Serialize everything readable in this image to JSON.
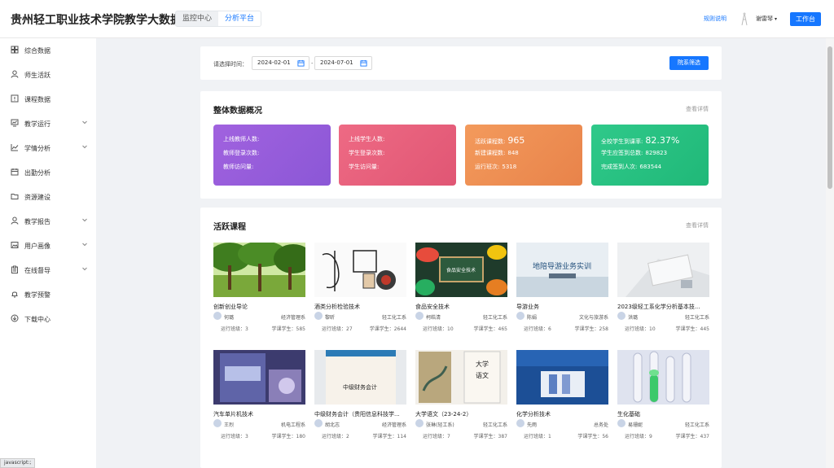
{
  "header": {
    "brand": "贵州轻工职业技术学院教学大数据",
    "tabs": [
      "监控中心",
      "分析平台"
    ],
    "rules_link": "规则说明",
    "user_name": "谢雷琴",
    "workbench_label": "工作台"
  },
  "sidebar": {
    "items": [
      {
        "label": "综合数据",
        "icon": "grid-icon",
        "expandable": false
      },
      {
        "label": "师生活跃",
        "icon": "user-icon",
        "expandable": false
      },
      {
        "label": "课程数据",
        "icon": "info-box-icon",
        "expandable": false
      },
      {
        "label": "教学运行",
        "icon": "monitor-chart-icon",
        "expandable": true
      },
      {
        "label": "学情分析",
        "icon": "line-chart-icon",
        "expandable": true
      },
      {
        "label": "出勤分析",
        "icon": "calendar-icon",
        "expandable": false
      },
      {
        "label": "资源建设",
        "icon": "folder-icon",
        "expandable": false
      },
      {
        "label": "教学报告",
        "icon": "user-report-icon",
        "expandable": true
      },
      {
        "label": "用户画像",
        "icon": "image-icon",
        "expandable": true
      },
      {
        "label": "在线督导",
        "icon": "clipboard-icon",
        "expandable": true
      },
      {
        "label": "教学预警",
        "icon": "bell-icon",
        "expandable": false
      },
      {
        "label": "下载中心",
        "icon": "download-icon",
        "expandable": false
      }
    ]
  },
  "filter": {
    "label": "请选择时间：",
    "start_date": "2024-02-01",
    "end_date": "2024-07-01",
    "separator": "-",
    "button_label": "院系筛选"
  },
  "overview": {
    "title": "整体数据概况",
    "more": "查看详情",
    "boxes": [
      {
        "color_from": "#a162df",
        "color_to": "#8b57d6",
        "lines": [
          {
            "label": "上线教师人数:",
            "value": ""
          },
          {
            "label": "教师登录次数:",
            "value": ""
          },
          {
            "label": "教师访问量:",
            "value": ""
          }
        ]
      },
      {
        "color_from": "#ee6a84",
        "color_to": "#e05674",
        "lines": [
          {
            "label": "上线学生人数:",
            "value": ""
          },
          {
            "label": "学生登录次数:",
            "value": ""
          },
          {
            "label": "学生访问量:",
            "value": ""
          }
        ]
      },
      {
        "color_from": "#f39a5c",
        "color_to": "#e8834a",
        "lines": [
          {
            "label": "活跃课程数:",
            "value": "965"
          },
          {
            "label": "新建课程数:",
            "value": "848"
          },
          {
            "label": "运行班次:",
            "value": "5318"
          }
        ]
      },
      {
        "color_from": "#2fc98a",
        "color_to": "#20b878",
        "lines": [
          {
            "label": "全校学生到课率:",
            "value": "82.37%"
          },
          {
            "label": "学生应签到总数:",
            "value": "829823"
          },
          {
            "label": "完成签到人次:",
            "value": "683544"
          }
        ]
      }
    ]
  },
  "courses": {
    "title": "活跃课程",
    "more": "查看详情",
    "classes_label": "运行班级：",
    "students_label": "学课学生：",
    "items": [
      {
        "title": "创新创业导论",
        "teacher": "何璐",
        "dept": "经济管理系",
        "classes": "3",
        "students": "585",
        "thumb": "forest"
      },
      {
        "title": "酒类分析检验技术",
        "teacher": "黎昕",
        "dept": "轻工化工系",
        "classes": "27",
        "students": "2644",
        "thumb": "wine"
      },
      {
        "title": "食品安全技术",
        "teacher": "柯皓清",
        "dept": "轻工化工系",
        "classes": "10",
        "students": "465",
        "thumb": "food-safety"
      },
      {
        "title": "导游业务",
        "teacher": "陈娟",
        "dept": "文化与旅游系",
        "classes": "6",
        "students": "258",
        "thumb": "tour-guide"
      },
      {
        "title": "2023级轻工系化学分析基本技...",
        "teacher": "洪璐",
        "dept": "轻工化工系",
        "classes": "10",
        "students": "445",
        "thumb": "lab-desk"
      },
      {
        "title": "汽车单片机技术",
        "teacher": "王烈",
        "dept": "机电工程系",
        "classes": "3",
        "students": "180",
        "thumb": "book-mcu"
      },
      {
        "title": "中级财务会计（贵阳信息科技学...",
        "teacher": "胡北志",
        "dept": "经济管理系",
        "classes": "2",
        "students": "114",
        "thumb": "book-accounting"
      },
      {
        "title": "大学语文（23-24-2）",
        "teacher": "张琳(轻工系)",
        "dept": "轻工化工系",
        "classes": "7",
        "students": "387",
        "thumb": "book-chinese"
      },
      {
        "title": "化学分析技术",
        "teacher": "先雨",
        "dept": "总务处",
        "classes": "1",
        "students": "56",
        "thumb": "chem-analysis"
      },
      {
        "title": "生化基础",
        "teacher": "易珊妮",
        "dept": "轻工化工系",
        "classes": "9",
        "students": "437",
        "thumb": "test-tubes"
      }
    ]
  },
  "status_hint": "javascript:;"
}
